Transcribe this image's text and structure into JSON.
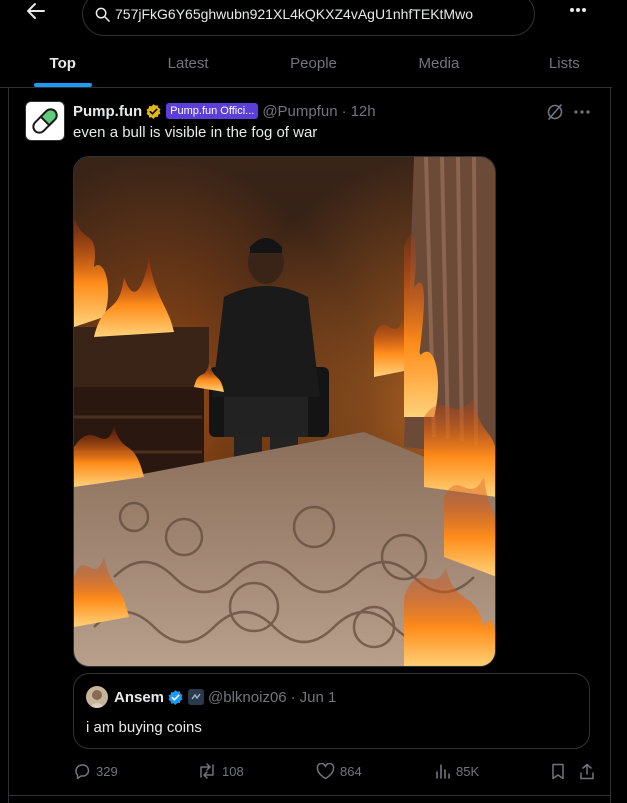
{
  "search": {
    "value": "757jFkG6Y65ghwubn921XL4kQKXZ4vAgU1nhfTEKtMwo"
  },
  "tabs": [
    {
      "label": "Top"
    },
    {
      "label": "Latest"
    },
    {
      "label": "People"
    },
    {
      "label": "Media"
    },
    {
      "label": "Lists"
    }
  ],
  "tweet": {
    "name": "Pump.fun",
    "affiliation": "Pump.fun Offici...",
    "handle": "@Pumpfun",
    "time": "12h",
    "text": "even a bull is visible in the fog of war",
    "quote": {
      "name": "Ansem",
      "handle": "@blknoiz06",
      "time": "Jun 1",
      "text": "i am buying coins"
    },
    "stats": {
      "replies": "329",
      "reposts": "108",
      "likes": "864",
      "views": "85K"
    }
  },
  "colors": {
    "accent": "#1d9bf0",
    "verified_gold": "#e2b719",
    "verified_blue": "#1d9bf0",
    "affiliation_badge": "#5b3fd8",
    "muted_text": "#71767b"
  }
}
